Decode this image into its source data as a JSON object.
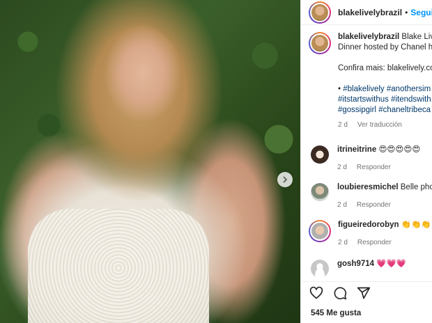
{
  "post": {
    "username": "blakelivelybrazil",
    "separator": "•",
    "follow_label": "Seguir"
  },
  "caption": {
    "username": "blakelivelybrazil",
    "line1": "Blake Live",
    "line2": "Dinner hosted by Chanel h",
    "line3": "Confira mais: blakelively.co",
    "bullet": "•",
    "tags_line1": [
      "#blakelively",
      "#anothersim"
    ],
    "tags_line2": [
      "#itstartswithus",
      "#itendswith"
    ],
    "tags_line3": [
      "#gossipgirl",
      "#chaneltribeca"
    ],
    "time": "2 d",
    "translate": "Ver traducción"
  },
  "comments": [
    {
      "username": "itrineitrine",
      "text": "😍😍😍😍😍",
      "time": "2 d",
      "reply": "Responder"
    },
    {
      "username": "loubieresmichel",
      "text": "Belle phot",
      "time": "2 d",
      "reply": "Responder"
    },
    {
      "username": "figueiredorobyn",
      "text": "👏👏👏",
      "time": "2 d",
      "reply": "Responder"
    },
    {
      "username": "gosh9714",
      "text": "💗💗💗",
      "time": "",
      "reply": ""
    }
  ],
  "likes": "545 Me gusta",
  "colors": {
    "link": "#0095f6",
    "hashtag": "#00376b",
    "muted": "#737373"
  }
}
